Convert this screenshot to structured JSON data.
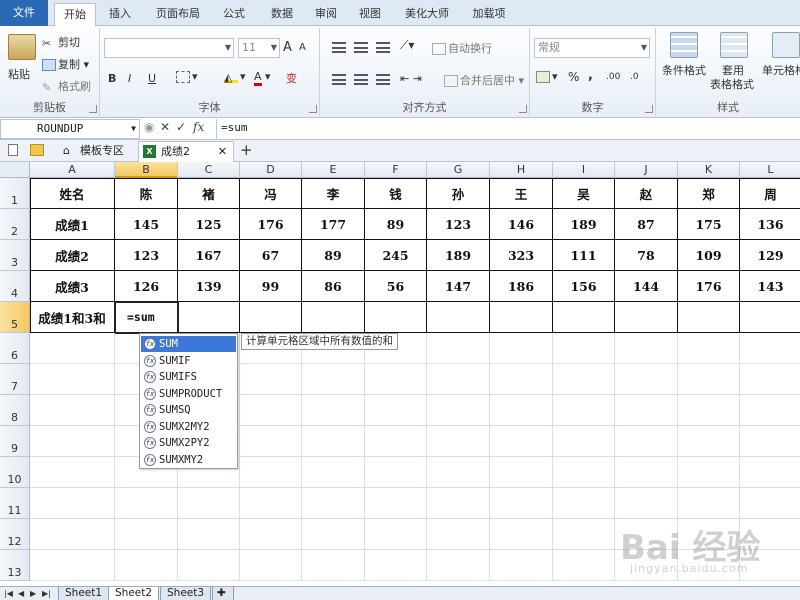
{
  "ribbon_tabs": [
    "文件",
    "开始",
    "插入",
    "页面布局",
    "公式",
    "数据",
    "审阅",
    "视图",
    "美化大师",
    "加载项"
  ],
  "active_tab": "开始",
  "clipboard": {
    "paste": "粘贴",
    "cut": "剪切",
    "copy": "复制",
    "format_painter": "格式刷",
    "label": "剪贴板"
  },
  "font": {
    "size": "11",
    "bold": "B",
    "italic": "I",
    "underline": "U",
    "label": "字体",
    "grow": "A",
    "shrink": "A",
    "color": "A",
    "phonetic": "变"
  },
  "alignment": {
    "wrap": "自动换行",
    "merge": "合并后居中",
    "label": "对齐方式"
  },
  "number": {
    "format": "常规",
    "percent": "%",
    "comma": ",",
    "inc_decimal": ".00",
    "dec_decimal": ".0",
    "label": "数字"
  },
  "styles": {
    "conditional": "条件格式",
    "table": "套用",
    "table2": "表格格式",
    "cell": "单元格格",
    "label": "样式"
  },
  "formula_bar": {
    "name_box": "ROUNDUP",
    "cancel": "✕",
    "enter": "✓",
    "fx": "fx",
    "content": "=sum"
  },
  "doc_tabs": {
    "template": "模板专区",
    "workbook": "成绩2",
    "add": "+"
  },
  "columns": [
    "A",
    "B",
    "C",
    "D",
    "E",
    "F",
    "G",
    "H",
    "I",
    "J",
    "K",
    "L"
  ],
  "rows": [
    "1",
    "2",
    "3",
    "4",
    "5",
    "6",
    "7",
    "8",
    "9",
    "10",
    "11",
    "12",
    "13"
  ],
  "table": [
    [
      "姓名",
      "陈",
      "褚",
      "冯",
      "李",
      "钱",
      "孙",
      "王",
      "吴",
      "赵",
      "郑",
      "周"
    ],
    [
      "成绩1",
      "145",
      "125",
      "176",
      "177",
      "89",
      "123",
      "146",
      "189",
      "87",
      "175",
      "136"
    ],
    [
      "成绩2",
      "123",
      "167",
      "67",
      "89",
      "245",
      "189",
      "323",
      "111",
      "78",
      "109",
      "129"
    ],
    [
      "成绩3",
      "126",
      "139",
      "99",
      "86",
      "56",
      "147",
      "186",
      "156",
      "144",
      "176",
      "143"
    ],
    [
      "成绩1和3和",
      "=sum",
      "",
      "",
      "",
      "",
      "",
      "",
      "",
      "",
      "",
      ""
    ]
  ],
  "autocomplete": {
    "items": [
      "SUM",
      "SUMIF",
      "SUMIFS",
      "SUMPRODUCT",
      "SUMSQ",
      "SUMX2MY2",
      "SUMX2PY2",
      "SUMXMY2"
    ],
    "tooltip": "计算单元格区域中所有数值的和"
  },
  "sheet_tabs": [
    "Sheet1",
    "Sheet2",
    "Sheet3"
  ],
  "active_sheet": "Sheet2",
  "watermark": {
    "line1": "Bai 经验",
    "line2": "jingyan.baidu.com"
  },
  "colors": {
    "accent": "#2a6ab5",
    "header_selected": "#f5c860",
    "ac_selected": "#3b78d8"
  }
}
